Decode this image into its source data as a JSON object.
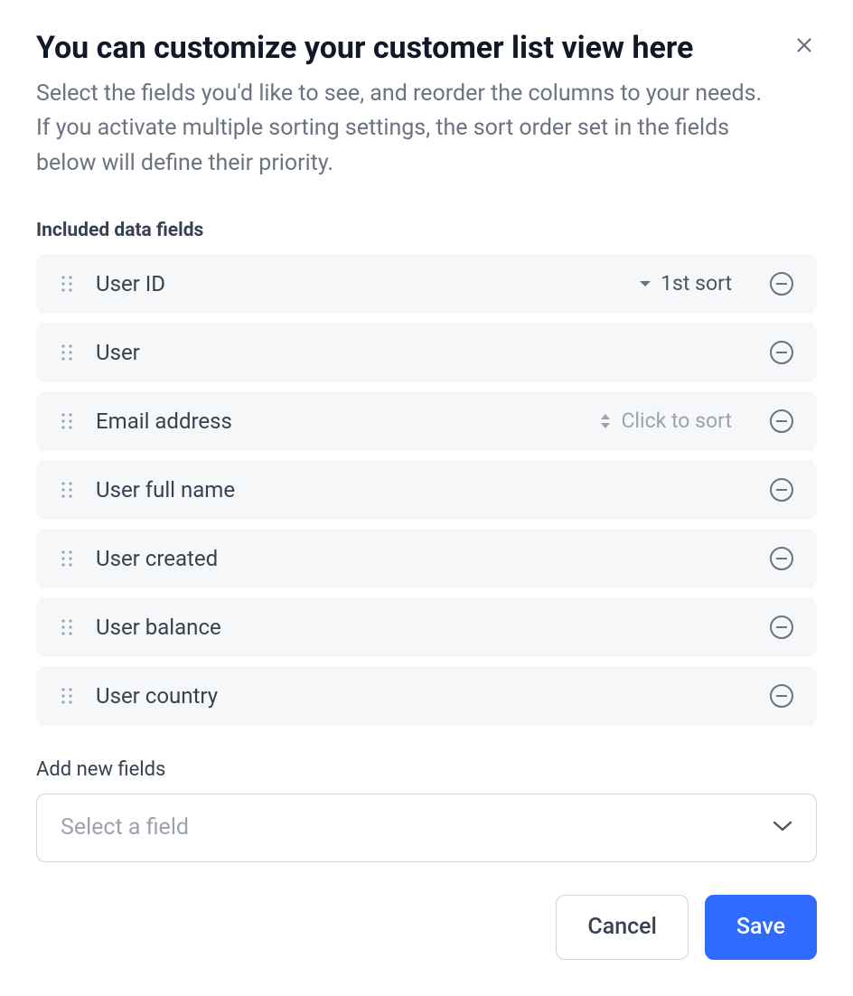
{
  "dialog": {
    "title": "You can customize your customer list view here",
    "subtitle": "Select the fields you'd like to see, and reorder the columns to your needs. If you activate multiple sorting settings, the sort order set in the fields below will define their priority."
  },
  "sections": {
    "included_label": "Included data fields",
    "add_label": "Add new fields",
    "select_placeholder": "Select a field"
  },
  "fields": [
    {
      "name": "User ID",
      "sort_label": "1st sort",
      "sort_state": "desc"
    },
    {
      "name": "User",
      "sort_label": "",
      "sort_state": "none"
    },
    {
      "name": "Email address",
      "sort_label": "Click to sort",
      "sort_state": "hint"
    },
    {
      "name": "User full name",
      "sort_label": "",
      "sort_state": "none"
    },
    {
      "name": "User created",
      "sort_label": "",
      "sort_state": "none"
    },
    {
      "name": "User balance",
      "sort_label": "",
      "sort_state": "none"
    },
    {
      "name": "User country",
      "sort_label": "",
      "sort_state": "none"
    }
  ],
  "footer": {
    "cancel": "Cancel",
    "save": "Save"
  }
}
